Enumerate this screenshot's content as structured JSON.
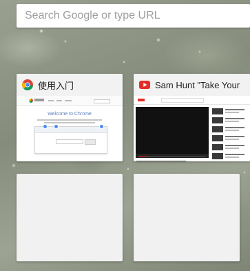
{
  "search": {
    "placeholder": "Search Google or type URL",
    "value": ""
  },
  "tiles": [
    {
      "title": "使用入门",
      "favicon": "chrome-icon",
      "thumbnail_heading": "Welcome to Chrome"
    },
    {
      "title": "Sam Hunt \"Take Your",
      "favicon": "youtube-icon",
      "thumbnail_site": "YouTube"
    },
    {
      "title": ""
    },
    {
      "title": ""
    }
  ],
  "colors": {
    "youtube_red": "#e52d27",
    "tile_background": "#f2f2f2",
    "search_background": "#ffffff"
  }
}
